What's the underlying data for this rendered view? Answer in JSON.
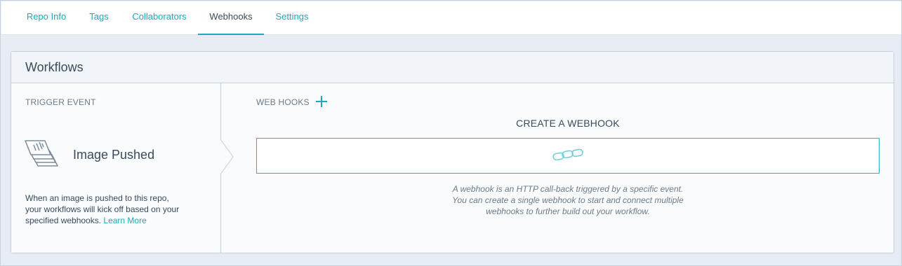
{
  "tabs": [
    {
      "label": "Repo Info",
      "active": false
    },
    {
      "label": "Tags",
      "active": false
    },
    {
      "label": "Collaborators",
      "active": false
    },
    {
      "label": "Webhooks",
      "active": true
    },
    {
      "label": "Settings",
      "active": false
    }
  ],
  "panel": {
    "title": "Workflows",
    "trigger": {
      "label": "TRIGGER EVENT",
      "event_name": "Image Pushed",
      "icon": "image-layers-icon",
      "description": "When an image is pushed to this repo, your workflows will kick off based on your specified webhooks. ",
      "learn_more": "Learn More"
    },
    "webhooks": {
      "label": "WEB HOOKS",
      "add_icon": "plus-icon",
      "create_title": "CREATE A WEBHOOK",
      "input_icon": "link-icon",
      "help_line1": "A webhook is an HTTP call-back triggered by a specific event.",
      "help_line2": "You can create a single webhook to start and connect multiple",
      "help_line3": "webhooks to further build out your workflow."
    }
  },
  "colors": {
    "accent": "#1aaaba",
    "text": "#394b5b",
    "muted": "#6b7b8a",
    "background": "#e7ecf4",
    "border": "#c4d0dc"
  }
}
